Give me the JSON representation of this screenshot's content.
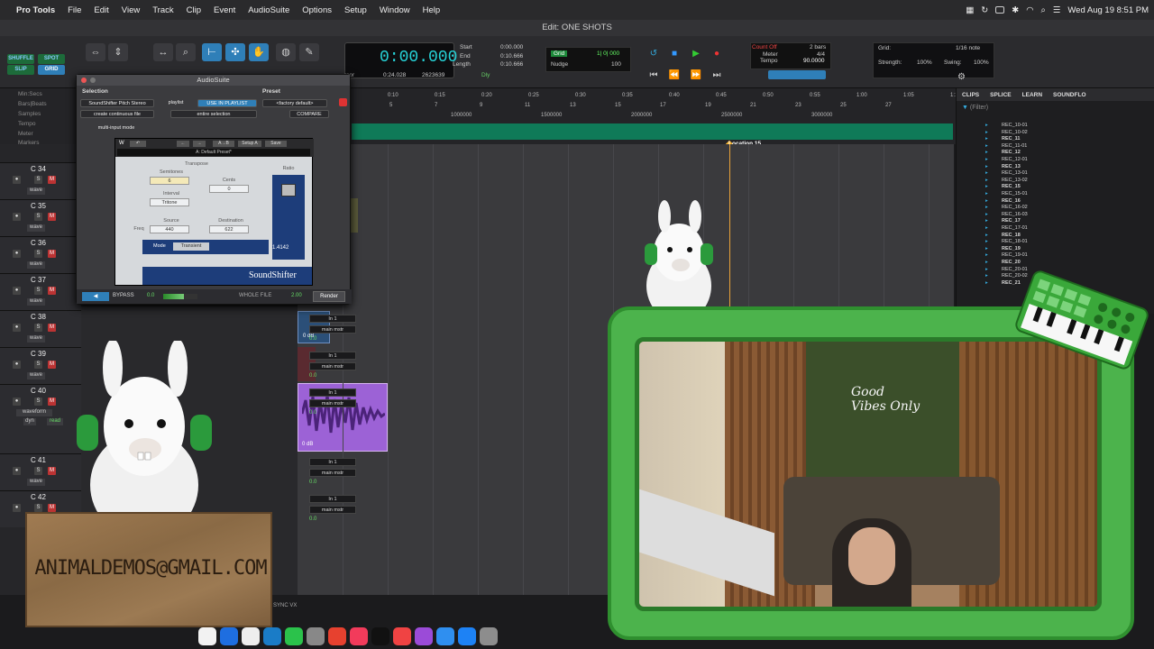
{
  "menubar": {
    "apple": "",
    "app": "Pro Tools",
    "items": [
      "File",
      "Edit",
      "View",
      "Track",
      "Clip",
      "Event",
      "AudioSuite",
      "Options",
      "Setup",
      "Window",
      "Help"
    ],
    "datetime": "Wed Aug 19  8:51 PM"
  },
  "window": {
    "title": "Edit: ONE SHOTS"
  },
  "toolbar": {
    "modes": [
      "SHUFFLE",
      "SPOT",
      "SLIP",
      "GRID"
    ],
    "counter_main": "0:00.000",
    "start_label": "Start",
    "end_label": "End",
    "length_label": "Length",
    "start_val": "0:00.000",
    "end_val": "0:10.666",
    "length_val": "0:10.666",
    "cursor_label": "rsor",
    "cursor_val": "0:24.028",
    "sample_val": "2623639",
    "dly": "Dly",
    "grid_label": "Grid",
    "grid_val": "1| 0| 000",
    "nudge_label": "Nudge",
    "nudge_val": "100",
    "count_off": "Count Off",
    "meter": "Meter",
    "tempo": "Tempo",
    "bars": "2 bars",
    "meter_val": "4/4",
    "tempo_val": "90.0000",
    "grid2_label": "Grid:",
    "grid2_val": "1/16 note",
    "strength_label": "Strength:",
    "strength_val": "100%",
    "swing_label": "Swing:",
    "swing_val": "100%"
  },
  "rulers": [
    "Min:Secs",
    "Bars|Beats",
    "Samples",
    "Tempo",
    "Meter",
    "Markers"
  ],
  "ruler_ticks": [
    "0:10",
    "0:15",
    "0:20",
    "0:25",
    "0:30",
    "0:35",
    "0:40",
    "0:45",
    "0:50",
    "0:55",
    "1:00",
    "1:05",
    "1:10"
  ],
  "bar_ticks": [
    "5",
    "7",
    "9",
    "11",
    "13",
    "15",
    "17",
    "19",
    "21",
    "23",
    "25",
    "27"
  ],
  "sample_ticks": [
    "1000000",
    "1500000",
    "2000000",
    "2500000",
    "3000000"
  ],
  "location_marker": "Location 15",
  "tracks": [
    {
      "name": "C 34",
      "w": "wave"
    },
    {
      "name": "C 35",
      "w": "wave"
    },
    {
      "name": "C 36",
      "w": "wave"
    },
    {
      "name": "C 37",
      "w": "wave"
    },
    {
      "name": "C 38",
      "w": "wave"
    },
    {
      "name": "C 39",
      "w": "wave"
    },
    {
      "name": "C 40",
      "w": "waveform"
    },
    {
      "name": "C 41",
      "w": "wave"
    },
    {
      "name": "C 42",
      "w": "wave"
    }
  ],
  "io": {
    "in": "In 1",
    "out": "main mstr",
    "vol": "0.0",
    "pan": "0",
    "vol_label": "vol",
    "pan_label": "pan",
    "dyn": "dyn",
    "read": "read"
  },
  "clip_gain": "0 dB",
  "clips_panel": {
    "tabs": [
      "CLIPS",
      "SPLICE",
      "LEARN",
      "SOUNDFLO"
    ],
    "filter": "(Filter)",
    "items": [
      "REC_10-01",
      "REC_10-02",
      "REC_11",
      "REC_11-01",
      "REC_12",
      "REC_12-01",
      "REC_13",
      "REC_13-01",
      "REC_13-02",
      "REC_15",
      "REC_15-01",
      "REC_16",
      "REC_16-02",
      "REC_16-03",
      "REC_17",
      "REC_17-01",
      "REC_18",
      "REC_18-01",
      "REC_19",
      "REC_19-01",
      "REC_20",
      "REC_20-01",
      "REC_20-02",
      "REC_21"
    ]
  },
  "audiosuite": {
    "title": "AudioSuite",
    "selection": "Selection",
    "preset": "Preset",
    "plugin": "SoundShifter Pitch Stereo",
    "playlist": "playlist",
    "use_in_playlist": "USE IN PLAYLIST",
    "factory_default": "<factory default>",
    "processing": "create continuous file",
    "entire_selection": "entire selection",
    "compare": "COMPARE",
    "multi_input": "multi-input mode",
    "preset_name": "A: Default Preset*",
    "setup_a": "Setup A",
    "save": "Save",
    "transpose": "Transpose",
    "semitones_label": "Semitones",
    "semitones": "6",
    "cents_label": "Cents",
    "cents": "0",
    "interval_label": "Interval",
    "interval": "Tritone",
    "ratio_label": "Ratio",
    "ratio": "1.4142",
    "source_label": "Source",
    "source": "440",
    "destination_label": "Destination",
    "destination": "622",
    "freq_label": "Freq",
    "mode_label": "Mode",
    "mode": "Transient",
    "logo": "SoundShifter",
    "bypass": "BYPASS",
    "bypass_val": "0.0",
    "whole_file": "WHOLE FILE",
    "whole_val": "2.00",
    "render": "Render"
  },
  "overlay": {
    "email": "ANIMALDEMOS@GMAIL.COM",
    "neon_sign": "Good Vibes Only"
  },
  "bottom": {
    "sync": "SYNC VX"
  }
}
